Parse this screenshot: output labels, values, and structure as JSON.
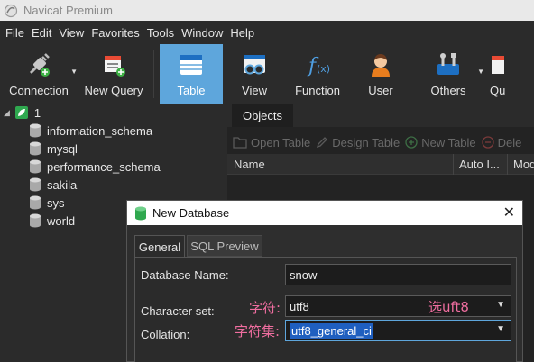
{
  "window": {
    "title": "Navicat Premium"
  },
  "menu": [
    "File",
    "Edit",
    "View",
    "Favorites",
    "Tools",
    "Window",
    "Help"
  ],
  "toolbar": {
    "connection": "Connection",
    "new_query": "New Query",
    "table": "Table",
    "view": "View",
    "function": "Function",
    "user": "User",
    "others": "Others",
    "query_partial": "Qu"
  },
  "tree": {
    "connection_name": "1",
    "databases": [
      "information_schema",
      "mysql",
      "performance_schema",
      "sakila",
      "sys",
      "world"
    ]
  },
  "main": {
    "tab": "Objects",
    "actions": {
      "open": "Open Table",
      "design": "Design Table",
      "new": "New Table",
      "delete": "Dele"
    },
    "columns": {
      "name": "Name",
      "auto": "Auto I...",
      "mod": "Mod"
    }
  },
  "dialog": {
    "title": "New Database",
    "tabs": {
      "general": "General",
      "preview": "SQL Preview"
    },
    "labels": {
      "db_name": "Database Name:",
      "charset": "Character set:",
      "collation": "Collation:"
    },
    "values": {
      "db_name": "snow",
      "charset": "utf8",
      "collation": "utf8_general_ci"
    },
    "annotations": {
      "charset_cn": "字符:",
      "collation_cn": "字符集:",
      "pick": "选uft8"
    }
  },
  "colors": {
    "accent": "#5ea6dc",
    "annotation": "#f06ea0",
    "selection": "#1f5fbf"
  }
}
